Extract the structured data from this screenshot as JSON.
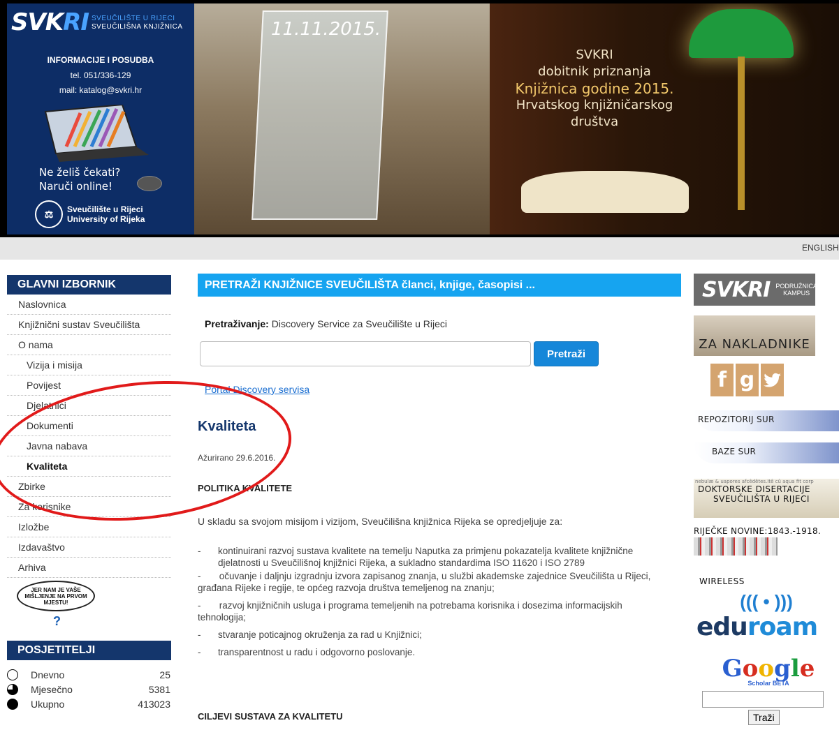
{
  "header": {
    "logo_main_a": "SVK",
    "logo_main_b": "RI",
    "logo_sub_line1": "SVEUČILIŠTE U RIJECI",
    "logo_sub_line2": "SVEUČILIŠNA KNJIŽNICA",
    "info_title": "INFORMACIJE I POSUDBA",
    "phone": "tel. 051/336-129",
    "email": "mail: katalog@svkri.hr",
    "order_line1": "Ne želiš čekati?",
    "order_line2": "Naruči online!",
    "uni_line1": "Sveučilište u Rijeci",
    "uni_line2": "University of Rijeka",
    "plaque_date": "11.11.2015.",
    "banner_line1": "SVKRI",
    "banner_line2": "dobitnik priznanja",
    "banner_line3": "Knjižnica godine 2015.",
    "banner_line4": "Hrvatskog knjižničarskog",
    "banner_line5": "društva"
  },
  "langbar": {
    "english_label": "ENGLISH"
  },
  "sidebar": {
    "menu_title": "GLAVNI IZBORNIK",
    "items": [
      {
        "label": "Naslovnica",
        "level": 0
      },
      {
        "label": "Knjižnični sustav Sveučilišta",
        "level": 0
      },
      {
        "label": "O nama",
        "level": 0
      },
      {
        "label": "Vizija i misija",
        "level": 1
      },
      {
        "label": "Povijest",
        "level": 1
      },
      {
        "label": "Djelatnici",
        "level": 1
      },
      {
        "label": "Dokumenti",
        "level": 1
      },
      {
        "label": "Javna nabava",
        "level": 1
      },
      {
        "label": "Kvaliteta",
        "level": 1,
        "active": true
      },
      {
        "label": "Zbirke",
        "level": 0
      },
      {
        "label": "Za korisnike",
        "level": 0
      },
      {
        "label": "Izložbe",
        "level": 0
      },
      {
        "label": "Izdavaštvo",
        "level": 0
      },
      {
        "label": "Arhiva",
        "level": 0
      }
    ],
    "feedback_text": "JER NAM JE VAŠE MIŠLJENJE NA PRVOM MJESTU!",
    "visitors_title": "POSJETITELJI",
    "visitors": [
      {
        "label": "Dnevno",
        "count": "25"
      },
      {
        "label": "Mjesečno",
        "count": "5381"
      },
      {
        "label": "Ukupno",
        "count": "413023"
      }
    ]
  },
  "main": {
    "search_banner": "PRETRAŽI KNJIŽNICE SVEUČILIŠTA članci, knjige, časopisi ...",
    "search_label_bold": "Pretraživanje:",
    "search_label_rest": " Discovery Service za Sveučilište u Rijeci",
    "search_value": "",
    "search_button": "Pretraži",
    "portal_link": "Portal Discovery servisa",
    "title": "Kvaliteta",
    "updated": "Ažurirano 29.6.2016.",
    "policy_heading": "POLITIKA KVALITETE",
    "intro": "U skladu sa svojom misijom i vizijom, Sveučilišna knjižnica Rijeka se opredjeljuje za:",
    "policy_items": [
      "kontinuirani razvoj sustava kvalitete na temelju Naputka za primjenu pokazatelja kvalitete knjižnične djelatnosti u Sveučilišnoj knjižnici Rijeka, a sukladno standardima ISO 11620 i ISO 2789",
      "očuvanje i daljnju izgradnju izvora zapisanog znanja, u službi akademske zajednice Sveučilišta u Rijeci, građana Rijeke i regije, te općeg razvoja društva temeljenog na znanju;",
      "razvoj knjižničnih usluga i programa temeljenih na potrebama korisnika i dosezima informacijskih tehnologija;",
      "stvaranje poticajnog okruženja za rad u Knjižnici;",
      "transparentnost u radu i odgovorno poslovanje."
    ],
    "goals_heading": "CILJEVI SUSTAVA ZA KVALITETU"
  },
  "right": {
    "kampus_logo": "SVKRI",
    "kampus_tag_line1": "PODRUŽNICA",
    "kampus_tag_line2": "KAMPUS",
    "nakladnike": "ZA NAKLADNIKE",
    "social_f": "f",
    "social_g": "g",
    "social_t": "t",
    "repo": "REPOZITORIJ SUR",
    "baze": "BAZE SUR",
    "disert_tiny": "nebulæ & uapores afcêdêtes.Itê cû aqua fit corp",
    "disert_l1": "DOKTORSKE DISERTACIJE",
    "disert_l2": "SVEUČILIŠTA U RIJECI",
    "novine": "RIJEČKE NOVINE:1843.-1918.",
    "wireless": "WIRELESS",
    "edu_a": "edu",
    "edu_b": "roam",
    "scholar_sub": "Scholar BETA",
    "scholar_value": "",
    "scholar_button": "Traži"
  }
}
